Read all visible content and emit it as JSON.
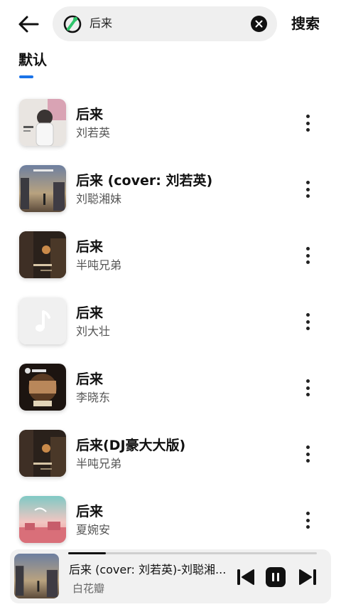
{
  "header": {
    "back_icon": "arrow-left-icon",
    "search_logo_icon": "qq-music-logo-icon",
    "search_query": "后来",
    "clear_icon": "clear-circle-icon",
    "search_button": "搜索"
  },
  "tabs": {
    "default_label": "默认",
    "indicator_color": "#1a73e8"
  },
  "songs": [
    {
      "title": "后来",
      "artist": "刘若英",
      "cover": "album-cover-girl-portrait"
    },
    {
      "title": "后来 (cover: 刘若英)",
      "artist": "刘聪湘妹",
      "cover": "album-cover-dusk-street"
    },
    {
      "title": "后来",
      "artist": "半吨兄弟",
      "cover": "album-cover-dark-street"
    },
    {
      "title": "后来",
      "artist": "刘大壮",
      "cover": "music-note-placeholder-icon"
    },
    {
      "title": "后来",
      "artist": "李晓东",
      "cover": "album-cover-singer-show"
    },
    {
      "title": "后来(DJ豪大大版)",
      "artist": "半吨兄弟",
      "cover": "album-cover-dark-street"
    },
    {
      "title": "后来",
      "artist": "夏婉安",
      "cover": "album-cover-pink-sky"
    }
  ],
  "player": {
    "title": "后来 (cover: 刘若英)-刘聪湘...",
    "artist": "白花瓣",
    "progress_fraction": 0.15,
    "prev_icon": "skip-previous-icon",
    "pause_icon": "pause-icon",
    "next_icon": "skip-next-icon"
  },
  "colors": {
    "accent": "#1a73e8",
    "text_primary": "#111111",
    "text_secondary": "#555555",
    "search_bg": "#efefef",
    "player_bg": "#f1f1f1"
  }
}
